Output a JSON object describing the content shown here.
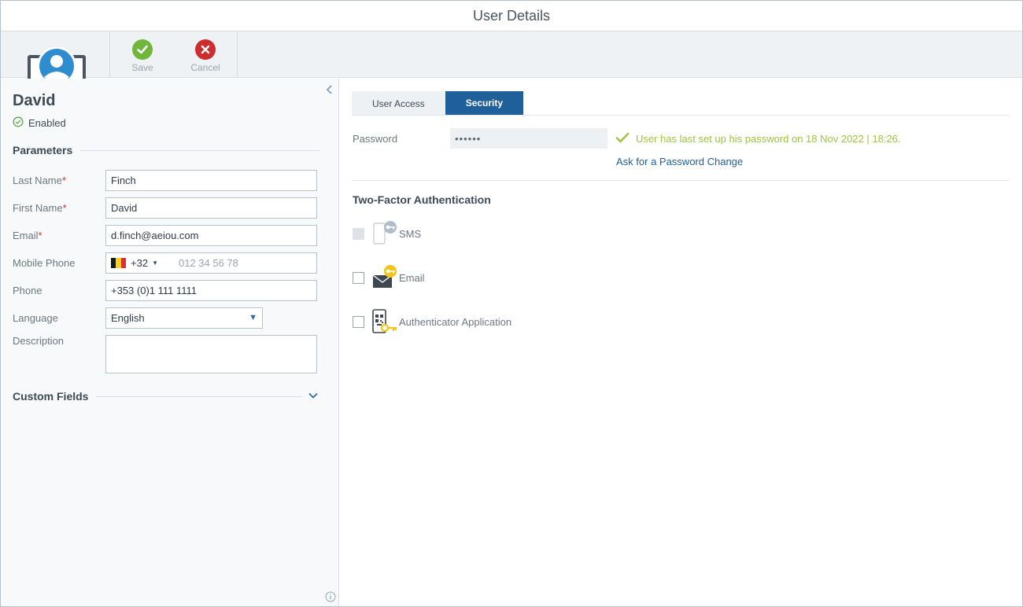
{
  "window": {
    "title": "User Details"
  },
  "toolbar": {
    "save_label": "Save",
    "cancel_label": "Cancel"
  },
  "user": {
    "name": "David",
    "status": "Enabled"
  },
  "parameters": {
    "heading": "Parameters",
    "last_name": {
      "label": "Last Name",
      "value": "Finch"
    },
    "first_name": {
      "label": "First Name",
      "value": "David"
    },
    "email": {
      "label": "Email",
      "value": "d.finch@aeiou.com"
    },
    "mobile_phone": {
      "label": "Mobile Phone",
      "country_code": "+32",
      "placeholder": "012 34 56 78"
    },
    "phone": {
      "label": "Phone",
      "value": "+353 (0)1 111 1111"
    },
    "language": {
      "label": "Language",
      "value": "English"
    },
    "description": {
      "label": "Description",
      "value": ""
    },
    "required_mark": "*"
  },
  "custom_fields": {
    "heading": "Custom Fields"
  },
  "tabs": [
    {
      "label": "User Access",
      "active": false
    },
    {
      "label": "Security",
      "active": true
    }
  ],
  "security": {
    "password_label": "Password",
    "password_mask": "••••••",
    "password_message": "User has last set up his password on 18 Nov 2022 | 18:26.",
    "password_change_link": "Ask for a Password Change"
  },
  "two_factor": {
    "heading": "Two-Factor Authentication",
    "options": [
      {
        "label": "SMS",
        "icon": "phone-key-icon",
        "checked": false,
        "disabled": true
      },
      {
        "label": "Email",
        "icon": "envelope-key-icon",
        "checked": false,
        "disabled": false
      },
      {
        "label": "Authenticator Application",
        "icon": "qr-phone-key-icon",
        "checked": false,
        "disabled": false
      }
    ]
  },
  "colors": {
    "accent": "#1f5f9a",
    "success": "#9cc43c",
    "save": "#6fb63a",
    "cancel": "#cc2d2d",
    "key": "#f0c419"
  }
}
